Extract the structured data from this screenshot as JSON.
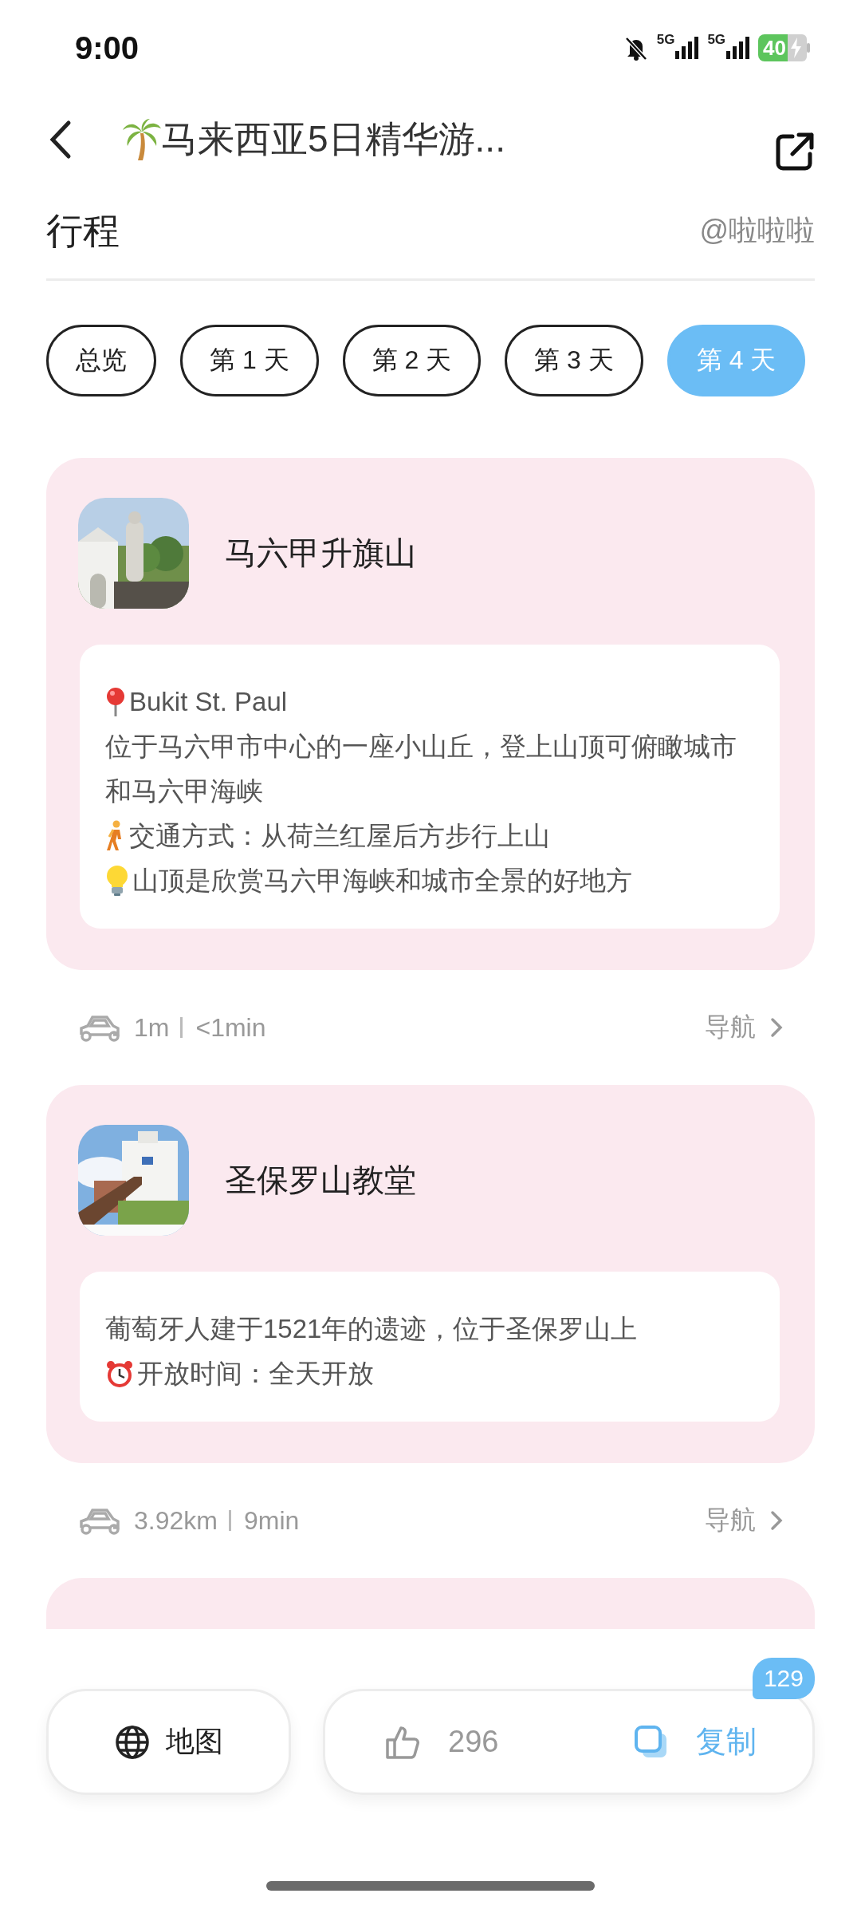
{
  "status_bar": {
    "time": "9:00",
    "networks": [
      "5G",
      "5G"
    ],
    "battery": "40"
  },
  "header": {
    "title": "马来西亚5日精华游..."
  },
  "section": {
    "title": "行程",
    "author": "@啦啦啦"
  },
  "tabs": [
    {
      "label": "总览",
      "selected": false
    },
    {
      "label": "第 1 天",
      "selected": false
    },
    {
      "label": "第 2 天",
      "selected": false
    },
    {
      "label": "第 3 天",
      "selected": false
    },
    {
      "label": "第 4 天",
      "selected": true
    }
  ],
  "spots": [
    {
      "name": "马六甲升旗山",
      "lines": [
        {
          "kind": "pin",
          "text": "Bukit St. Paul"
        },
        {
          "kind": "plain",
          "text": "位于马六甲市中心的一座小山丘，登上山顶可俯瞰城市和马六甲海峡"
        },
        {
          "kind": "walk",
          "text": "交通方式：从荷兰红屋后方步行上山"
        },
        {
          "kind": "bulb",
          "text": "山顶是欣赏马六甲海峡和城市全景的好地方"
        }
      ],
      "route": {
        "distance": "1m",
        "duration": "<1min",
        "nav": "导航"
      }
    },
    {
      "name": "圣保罗山教堂",
      "lines": [
        {
          "kind": "plain",
          "text": "葡萄牙人建于1521年的遗迹，位于圣保罗山上"
        },
        {
          "kind": "clock",
          "text": "开放时间：全天开放"
        }
      ],
      "route": {
        "distance": "3.92km",
        "duration": "9min",
        "nav": "导航"
      }
    }
  ],
  "bottom": {
    "map": "地图",
    "likes": "296",
    "copy": "复制",
    "copy_count": "129"
  }
}
